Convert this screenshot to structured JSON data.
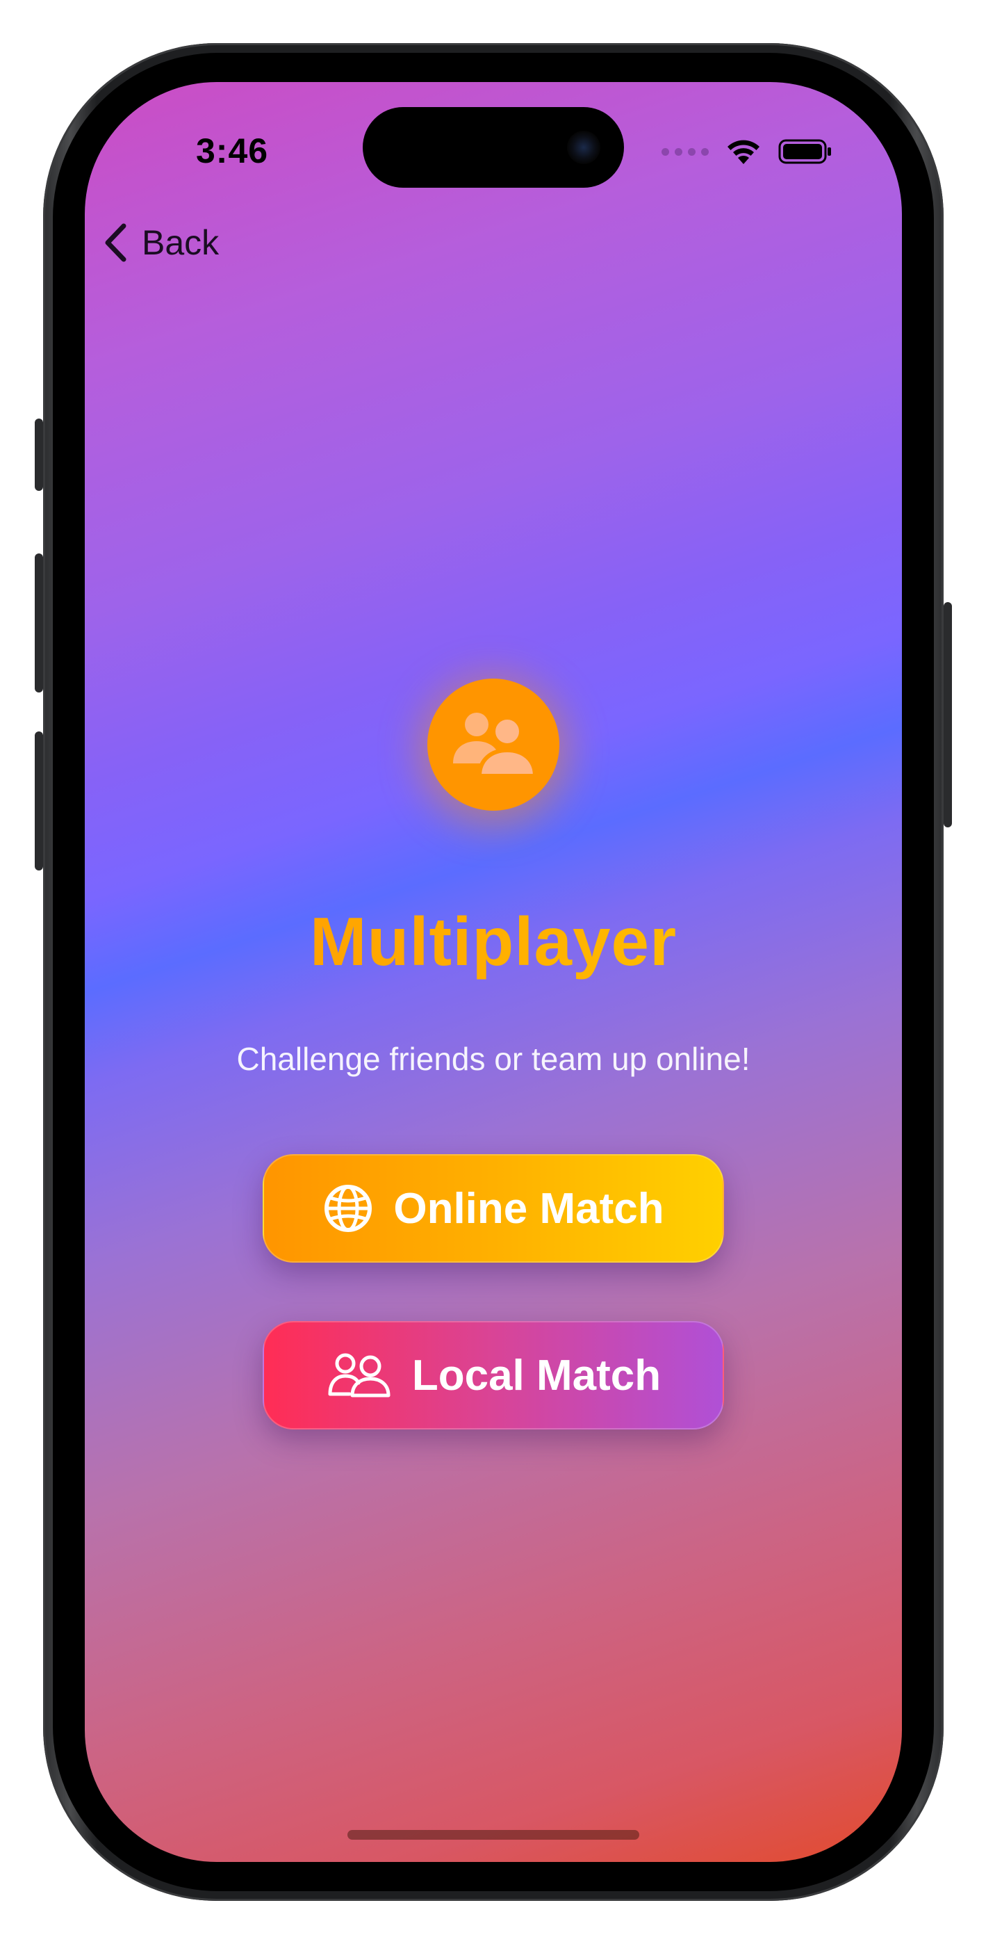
{
  "status_bar": {
    "time": "3:46",
    "icons": [
      "signal-dots-icon",
      "wifi-icon",
      "battery-icon"
    ]
  },
  "nav": {
    "back_label": "Back",
    "back_icon": "chevron-left-icon"
  },
  "hero": {
    "icon": "two-people-icon",
    "title": "Multiplayer",
    "subtitle": "Challenge friends or team up online!"
  },
  "buttons": {
    "online": {
      "label": "Online Match",
      "icon": "globe-icon"
    },
    "local": {
      "label": "Local Match",
      "icon": "two-people-outline-icon"
    }
  },
  "colors": {
    "accent_orange": "#ff9500",
    "accent_yellow": "#ffcc00",
    "accent_pink": "#ff2d55",
    "accent_purple": "#b050d6",
    "bg_top": "#cb4dc4",
    "bg_mid": "#5b6cff",
    "bg_bottom": "#e24b2e"
  }
}
